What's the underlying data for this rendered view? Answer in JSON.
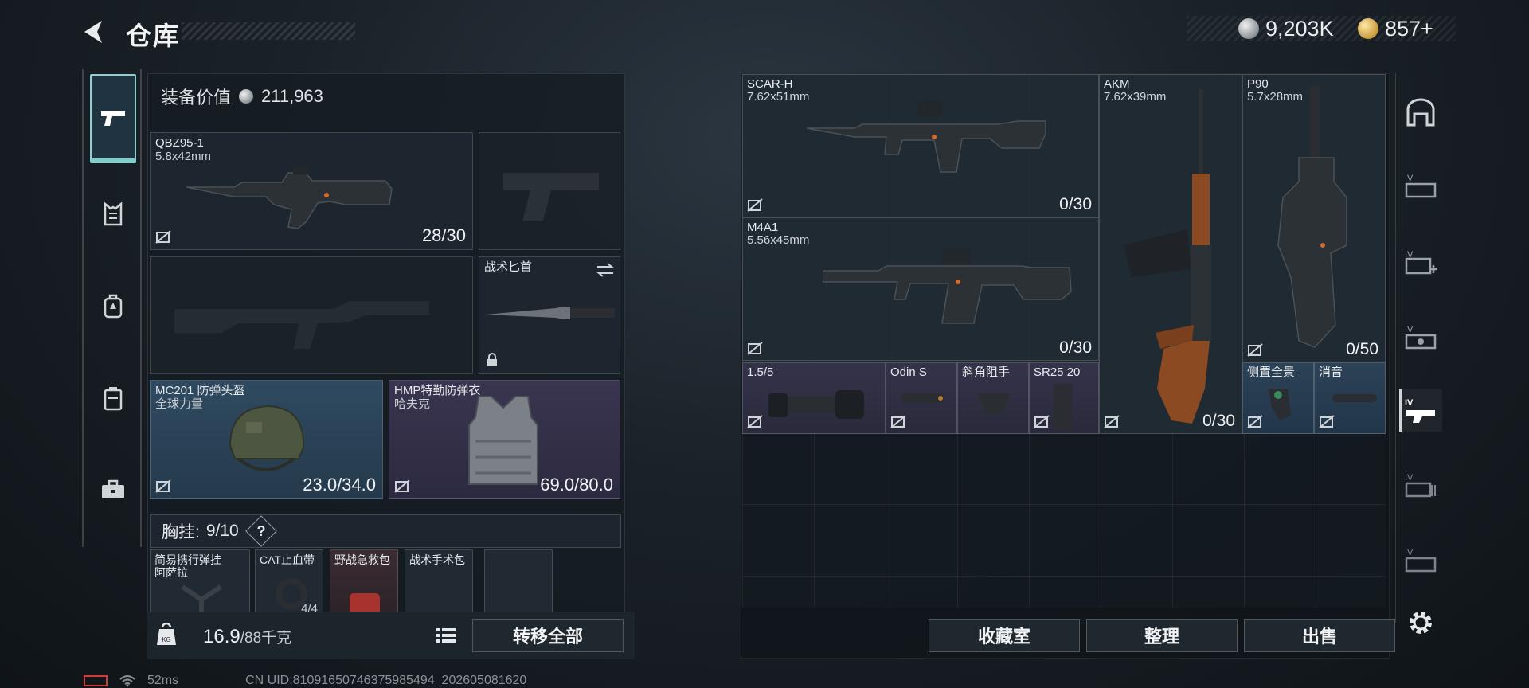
{
  "header": {
    "title": "仓库",
    "silver_amount": "9,203K",
    "gold_amount": "857+"
  },
  "left_tabs": [
    {
      "icon": "pistol-icon",
      "active": true
    },
    {
      "icon": "chest-rig-icon"
    },
    {
      "icon": "backpack-icon"
    },
    {
      "icon": "container-icon"
    },
    {
      "icon": "briefcase-icon"
    }
  ],
  "equipment": {
    "value_label": "装备价值",
    "value": "211,963",
    "primary_weapon": {
      "name": "QBZ95-1",
      "caliber": "5.8x42mm",
      "ammo": "28/30"
    },
    "knife": {
      "name": "战术匕首"
    },
    "helmet": {
      "name": "MC201 防弹头盔",
      "brand": "全球力量",
      "durability": "23.0/34.0"
    },
    "armor": {
      "name": "HMP特勤防弹衣",
      "brand": "哈夫克",
      "durability": "69.0/80.0"
    },
    "chest_rig": {
      "label": "胸挂:",
      "capacity": "9/10",
      "help": "?"
    },
    "rig_items": [
      {
        "name": "简易携行弹挂",
        "name2": "阿萨拉"
      },
      {
        "name": "CAT止血带",
        "count": "4/4"
      },
      {
        "name": "野战急救包"
      },
      {
        "name": "战术手术包"
      }
    ]
  },
  "bottom": {
    "weight": "16.9",
    "weight_max": "/88千克",
    "transfer_all": "转移全部",
    "collection": "收藏室",
    "organize": "整理",
    "sell": "出售"
  },
  "stash_items": [
    {
      "name": "SCAR-H",
      "caliber": "7.62x51mm",
      "ammo": "0/30"
    },
    {
      "name": "M4A1",
      "caliber": "5.56x45mm",
      "ammo": "0/30"
    },
    {
      "name": "AKM",
      "caliber": "7.62x39mm",
      "ammo": "0/30"
    },
    {
      "name": "P90",
      "caliber": "5.7x28mm",
      "ammo": "0/50"
    },
    {
      "name": "1.5/5"
    },
    {
      "name": "Odin S"
    },
    {
      "name": "斜角阻手"
    },
    {
      "name": "SR25 20"
    },
    {
      "name": "侧置全景"
    },
    {
      "name": "消音"
    }
  ],
  "status_bar": {
    "ping": "52ms",
    "uid": "CN UID:810916507463759854​94_202605081620"
  },
  "colors": {
    "accent_teal": "#7ad0c8",
    "quality_blue": "#2f4a60",
    "quality_purple": "#3a3550"
  }
}
